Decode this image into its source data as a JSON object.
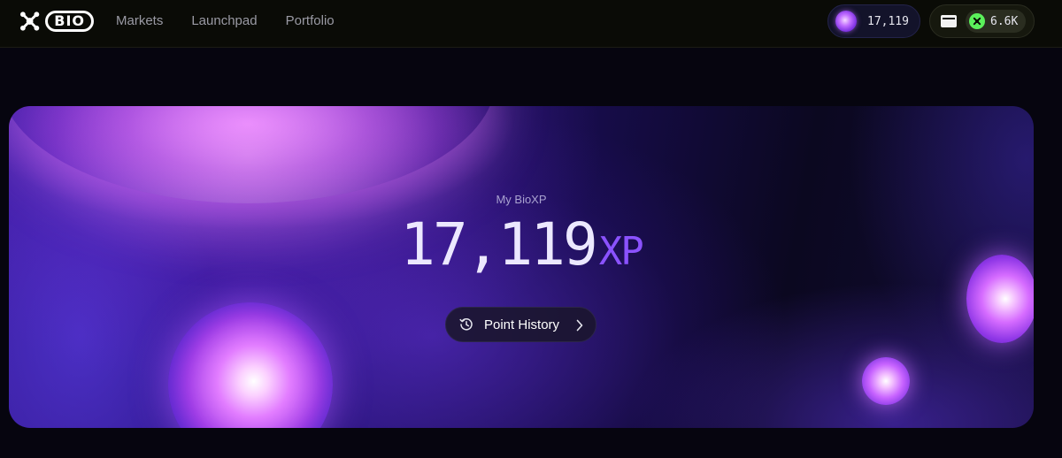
{
  "brand": {
    "logo_text": "BIO",
    "logo_icon": "bio-star-icon"
  },
  "nav": {
    "items": [
      {
        "label": "Markets"
      },
      {
        "label": "Launchpad"
      },
      {
        "label": "Portfolio"
      }
    ]
  },
  "header": {
    "xp_chip": {
      "icon": "xp-orb-icon",
      "value": "17,119"
    },
    "wallet_chip": {
      "icon": "wallet-icon",
      "token_icon": "bio-token-icon",
      "balance": "6.6K"
    }
  },
  "hero": {
    "label": "My BioXP",
    "value": "17,119",
    "unit": "XP",
    "history_button": {
      "icon": "history-icon",
      "label": "Point History",
      "chevron": "chevron-right-icon"
    }
  },
  "colors": {
    "accent": "#8b52ff",
    "background": "#06050f",
    "token_green": "#5bf05b"
  }
}
